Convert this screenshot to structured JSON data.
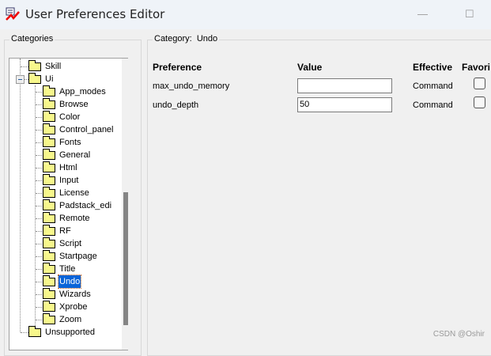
{
  "window": {
    "title": "User Preferences Editor",
    "minimize": "—",
    "maximize": "☐"
  },
  "categories": {
    "label": "Categories",
    "tree": [
      {
        "label": "Skill",
        "level": 0
      },
      {
        "label": "Ui",
        "level": 0,
        "expanded": true
      },
      {
        "label": "App_modes",
        "level": 1
      },
      {
        "label": "Browse",
        "level": 1
      },
      {
        "label": "Color",
        "level": 1
      },
      {
        "label": "Control_panel",
        "level": 1
      },
      {
        "label": "Fonts",
        "level": 1
      },
      {
        "label": "General",
        "level": 1
      },
      {
        "label": "Html",
        "level": 1
      },
      {
        "label": "Input",
        "level": 1
      },
      {
        "label": "License",
        "level": 1
      },
      {
        "label": "Padstack_edi",
        "level": 1
      },
      {
        "label": "Remote",
        "level": 1
      },
      {
        "label": "RF",
        "level": 1
      },
      {
        "label": "Script",
        "level": 1
      },
      {
        "label": "Startpage",
        "level": 1
      },
      {
        "label": "Title",
        "level": 1
      },
      {
        "label": "Undo",
        "level": 1,
        "selected": true
      },
      {
        "label": "Wizards",
        "level": 1
      },
      {
        "label": "Xprobe",
        "level": 1
      },
      {
        "label": "Zoom",
        "level": 1
      },
      {
        "label": "Unsupported",
        "level": 0
      }
    ]
  },
  "category": {
    "label": "Category:",
    "name": "Undo"
  },
  "table": {
    "headers": {
      "preference": "Preference",
      "value": "Value",
      "effective": "Effective",
      "favorite": "Favori"
    },
    "rows": [
      {
        "preference": "max_undo_memory",
        "value": "",
        "effective": "Command",
        "favorite": false
      },
      {
        "preference": "undo_depth",
        "value": "50",
        "effective": "Command",
        "favorite": false
      }
    ]
  },
  "watermark": "CSDN @Oshir"
}
